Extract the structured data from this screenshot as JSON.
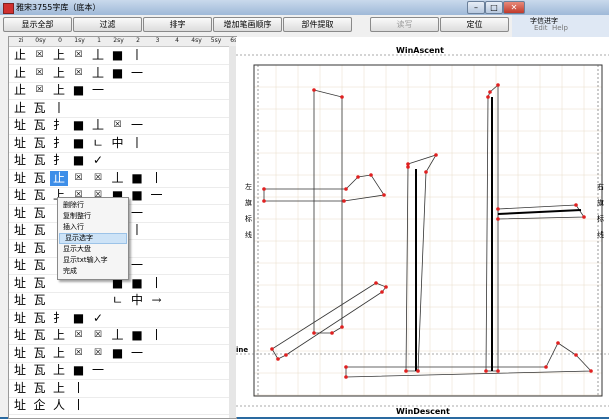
{
  "window": {
    "title": "雅宋3755字库（底本）"
  },
  "toolbar": {
    "buttons": [
      {
        "label": "显示全部",
        "enabled": true
      },
      {
        "label": "过滤",
        "enabled": true
      },
      {
        "label": "排字",
        "enabled": true
      },
      {
        "label": "增加笔画顺序",
        "enabled": true
      },
      {
        "label": "部件提取",
        "enabled": true
      },
      {
        "label": "读写",
        "enabled": false
      },
      {
        "label": "定位",
        "enabled": true
      }
    ]
  },
  "right_window": {
    "title": "字信进字",
    "menus": [
      "Edit",
      "Help"
    ]
  },
  "grid": {
    "headers": [
      "zi",
      "0sy",
      "0",
      "1sy",
      "1",
      "2sy",
      "2",
      "3",
      "4",
      "4sy",
      "5sy",
      "6sy",
      "7sy",
      "8",
      "9",
      "fullsize"
    ],
    "rows": [
      [
        "止",
        "☒",
        "上",
        "☒",
        "丄",
        "■",
        "丨"
      ],
      [
        "止",
        "☒",
        "上",
        "☒",
        "丄",
        "■",
        "一"
      ],
      [
        "止",
        "☒",
        "上",
        "■",
        "一",
        "",
        ""
      ],
      [
        "止",
        "瓦",
        "丨",
        "",
        "",
        "",
        ""
      ],
      [
        "址",
        "瓦",
        "扌",
        "■",
        "丄",
        "☒",
        "一"
      ],
      [
        "址",
        "瓦",
        "扌",
        "■",
        "ㄴ",
        "中",
        "丨"
      ],
      [
        "址",
        "瓦",
        "扌",
        "■",
        "✓",
        "",
        ""
      ],
      [
        "址",
        "瓦",
        "止",
        "☒",
        "☒",
        "丄",
        "■",
        "丨"
      ],
      [
        "址",
        "瓦",
        "上",
        "☒",
        "☒",
        "■",
        "■",
        "一"
      ],
      [
        "址",
        "瓦",
        "",
        "",
        "",
        "☒",
        "一"
      ],
      [
        "址",
        "瓦",
        "",
        "",
        "",
        "中",
        "丨"
      ],
      [
        "址",
        "瓦",
        "",
        "",
        "",
        "",
        ""
      ],
      [
        "址",
        "瓦",
        "",
        "",
        "",
        "☒",
        "一"
      ],
      [
        "址",
        "瓦",
        "",
        "",
        "",
        "■",
        "■",
        "丨"
      ],
      [
        "址",
        "瓦",
        "",
        "",
        "",
        "ㄴ",
        "中",
        "→"
      ],
      [
        "址",
        "瓦",
        "扌",
        "■",
        "✓",
        "",
        ""
      ],
      [
        "址",
        "瓦",
        "上",
        "☒",
        "☒",
        "丄",
        "■",
        "丨"
      ],
      [
        "址",
        "瓦",
        "上",
        "☒",
        "☒",
        "■",
        "一"
      ],
      [
        "址",
        "瓦",
        "上",
        "■",
        "一",
        "",
        ""
      ],
      [
        "址",
        "瓦",
        "上",
        "丨",
        "",
        "",
        ""
      ],
      [
        "址",
        "企",
        "人",
        "丨",
        "",
        "",
        ""
      ]
    ],
    "selected_row": 7,
    "selected_col": 2
  },
  "context_menu": {
    "items": [
      "删除行",
      "复制整行",
      "插入行",
      "显示选字",
      "显示大盘",
      "显示txt输入字",
      "完成"
    ],
    "highlighted": 3
  },
  "glyph_editor": {
    "top_label": "WinAscent",
    "bottom_label": "WinDescent",
    "baseline_label": "ine",
    "left_labels": [
      "左",
      "旗",
      "标",
      "线"
    ],
    "right_labels": [
      "右",
      "旗",
      "标",
      "线"
    ],
    "colors": {
      "outline": "#000000",
      "point": "#e02020",
      "guide": "#c8b098",
      "frame": "#333333"
    }
  }
}
